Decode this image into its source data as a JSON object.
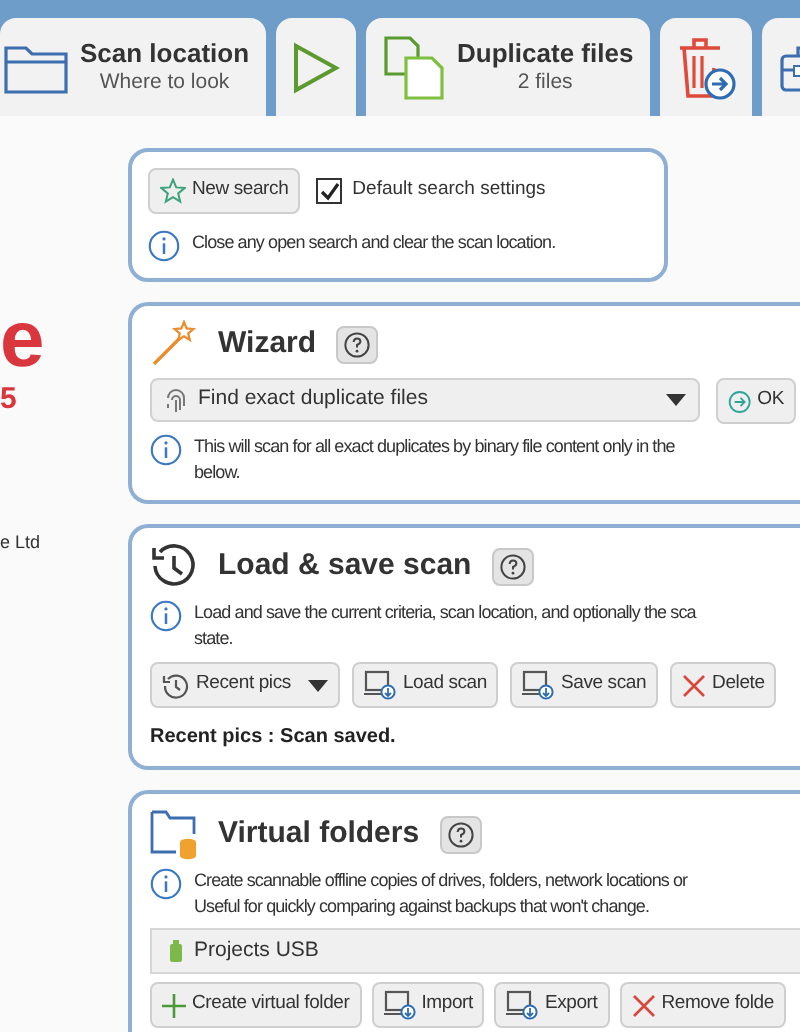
{
  "toolbar": {
    "tabs": [
      {
        "kind": "folder",
        "title": "Scan location",
        "subtitle": "Where to look"
      },
      {
        "kind": "play"
      },
      {
        "kind": "copies",
        "title": "Duplicate files",
        "subtitle": "2 files"
      },
      {
        "kind": "trash"
      },
      {
        "kind": "toolbox"
      }
    ]
  },
  "brand": {
    "letter": "e",
    "version": "5",
    "company": "e Ltd"
  },
  "start_panel": {
    "new_search": "New search",
    "default_settings": {
      "label": "Default search settings",
      "checked": true
    },
    "info": "Close any open search and clear the scan location."
  },
  "wizard": {
    "title": "Wizard",
    "mode": "Find exact duplicate files",
    "ok": "OK",
    "info_lines": [
      "This will scan for all exact duplicates by binary file content only in the",
      "below."
    ]
  },
  "load_save": {
    "title": "Load & save scan",
    "info_lines": [
      "Load and save the current criteria, scan location, and optionally the sca",
      "state."
    ],
    "buttons": [
      {
        "kind": "recent",
        "label": "Recent pics"
      },
      {
        "kind": "load",
        "label": "Load scan"
      },
      {
        "kind": "save",
        "label": "Save scan"
      },
      {
        "kind": "delete",
        "label": "Delete"
      }
    ],
    "status": "Recent pics : Scan saved."
  },
  "virtual_folders": {
    "title": "Virtual folders",
    "info_lines": [
      "Create scannable offline copies of drives, folders, network locations or",
      "Useful for quickly comparing against backups that won't change."
    ],
    "items": [
      {
        "label": "Projects USB",
        "selected": false
      }
    ],
    "buttons": [
      {
        "kind": "create",
        "label": "Create virtual folder"
      },
      {
        "kind": "import",
        "label": "Import"
      },
      {
        "kind": "export",
        "label": "Export"
      },
      {
        "kind": "remove",
        "label": "Remove folde"
      }
    ]
  }
}
